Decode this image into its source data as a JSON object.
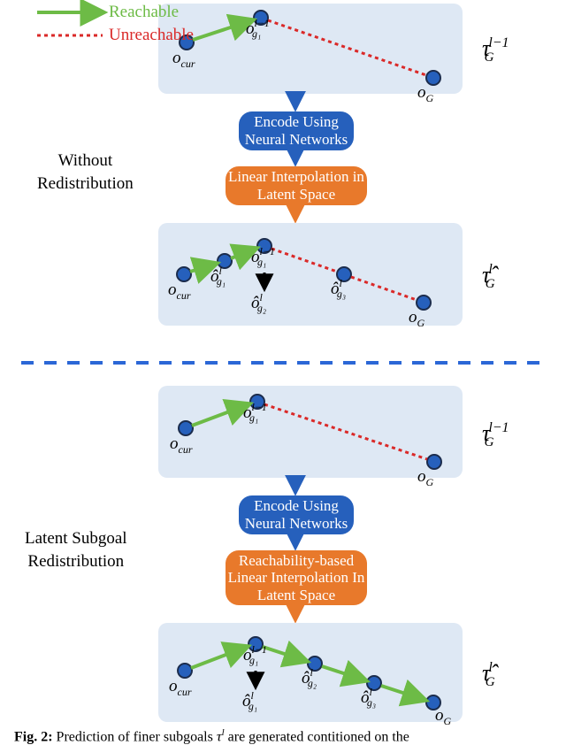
{
  "legend": {
    "reachable": "Reachable",
    "unreachable": "Unreachable"
  },
  "pill": {
    "encode": "Encode Using\nNeural Networks",
    "linear": "Linear Interpolation\nin Latent Space",
    "reach_linear": "Reachability-based\nLinear Interpolation\nIn Latent Space"
  },
  "side": {
    "without": "Without\nRedistribution",
    "latent": "Latent Subgoal\nRedistribution"
  },
  "tau": {
    "coarse": "τ",
    "coarse_sup_lm1": "l−1",
    "coarse_sub": "G",
    "fine_hat": "τ̂",
    "fine_sup_l": "l",
    "fine_sub": "G"
  },
  "nodes": {
    "o_cur": "o",
    "o_cur_sub": "cur",
    "o_g1_lm1": "o",
    "o_g1_lm1_sup": "l−1",
    "o_g1_lm1_sub": "g₁",
    "o_G": "o",
    "o_G_sub": "G",
    "ohat": "ô",
    "g1_sub": "g₁",
    "g2_sub": "g₂",
    "g3_sub": "g₃",
    "l_sup": "l"
  },
  "arrow": {
    "down": "⬇"
  },
  "caption": "Fig. 2: Prediction of finer subgoals τ  are generated contitioned on the",
  "caption_sup": "l"
}
